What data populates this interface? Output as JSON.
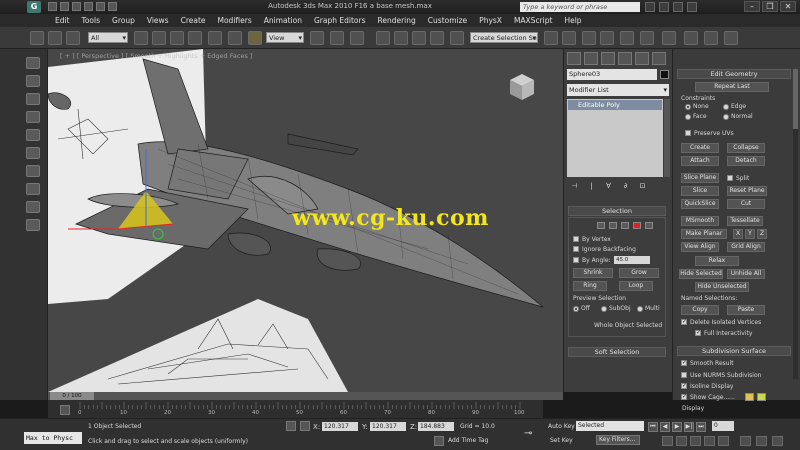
{
  "window": {
    "title": "Autodesk 3ds Max 2010     F16 a base mesh.max",
    "search_placeholder": "Type a keyword or phrase",
    "app_logo": "G",
    "controls": [
      "–",
      "❐",
      "✕"
    ]
  },
  "menu": [
    "Edit",
    "Tools",
    "Group",
    "Views",
    "Create",
    "Modifiers",
    "Animation",
    "Graph Editors",
    "Rendering",
    "Customize",
    "PhysX",
    "MAXScript",
    "Help"
  ],
  "toolbar": {
    "filter_value": "All",
    "coord_value": "View",
    "selection_set_placeholder": "Create Selection Se"
  },
  "viewport": {
    "label": "[ + ] [ Perspective ] [ Smooth + Highlights + Edged Faces ]",
    "watermark": "www.cg-ku.com"
  },
  "command_panel": {
    "object_name": "Sphere03",
    "modifier_list": "Modifier List",
    "stack_item": "Editable Poly",
    "stack_buttons": [
      "⊣",
      "|",
      "∀",
      "∂",
      "⊡"
    ],
    "selection": {
      "title": "Selection",
      "by_vertex": "By Vertex",
      "ignore_backfacing": "Ignore Backfacing",
      "by_angle": "By Angle:",
      "angle_value": "45.0",
      "shrink": "Shrink",
      "grow": "Grow",
      "ring": "Ring",
      "loop": "Loop",
      "preview_title": "Preview Selection",
      "preview_off": "Off",
      "preview_subobj": "SubObj",
      "preview_multi": "Multi",
      "status": "Whole Object Selected"
    },
    "soft_selection_title": "Soft Selection"
  },
  "right_panel": {
    "edit_geometry": {
      "title": "Edit Geometry",
      "repeat_last": "Repeat Last",
      "constraints_title": "Constraints",
      "none": "None",
      "edge": "Edge",
      "face": "Face",
      "normal": "Normal",
      "preserve_uvs": "Preserve UVs",
      "create": "Create",
      "collapse": "Collapse",
      "attach": "Attach",
      "detach": "Detach",
      "slice_plane": "Slice Plane",
      "split": "Split",
      "slice": "Slice",
      "reset_plane": "Reset Plane",
      "quickslice": "QuickSlice",
      "cut": "Cut",
      "msmooth": "MSmooth",
      "tessellate": "Tessellate",
      "make_planar": "Make Planar",
      "x": "X",
      "y": "Y",
      "z": "Z",
      "view_align": "View Align",
      "grid_align": "Grid Align",
      "relax": "Relax",
      "hide_selected": "Hide Selected",
      "unhide_all": "Unhide All",
      "hide_unselected": "Hide Unselected",
      "named_selections_title": "Named Selections:",
      "copy": "Copy",
      "paste": "Paste",
      "delete_isolated": "Delete Isolated Vertices",
      "full_interactivity": "Full Interactivity"
    },
    "subdivision": {
      "title": "Subdivision Surface",
      "smooth_result": "Smooth Result",
      "use_nurms": "Use NURMS Subdivision",
      "isoline_display": "Isoline Display",
      "show_cage": "Show Cage......",
      "display_title": "Display",
      "cage_color1": "#e0c050",
      "cage_color2": "#c8d850"
    }
  },
  "timeline": {
    "handle": "0 / 100",
    "ticks": [
      "0",
      "10",
      "20",
      "30",
      "40",
      "50",
      "60",
      "70",
      "80",
      "90",
      "100"
    ]
  },
  "status": {
    "maxscript": "Max to Physc",
    "line1": "1 Object Selected",
    "line2": "Click and drag to select and scale objects (uniformly)",
    "x_label": "X:",
    "x_value": "120.317",
    "y_label": "Y:",
    "y_value": "120.317",
    "z_label": "Z:",
    "z_value": "184.883",
    "grid": "Grid = 10.0",
    "add_time_tag": "Add Time Tag",
    "auto_key": "Auto Key",
    "set_key": "Set Key",
    "selected": "Selected",
    "key_filters": "Key Filters...",
    "frame": "0",
    "playback": [
      "⏮",
      "◀",
      "▶",
      "▶|",
      "⏭"
    ]
  }
}
